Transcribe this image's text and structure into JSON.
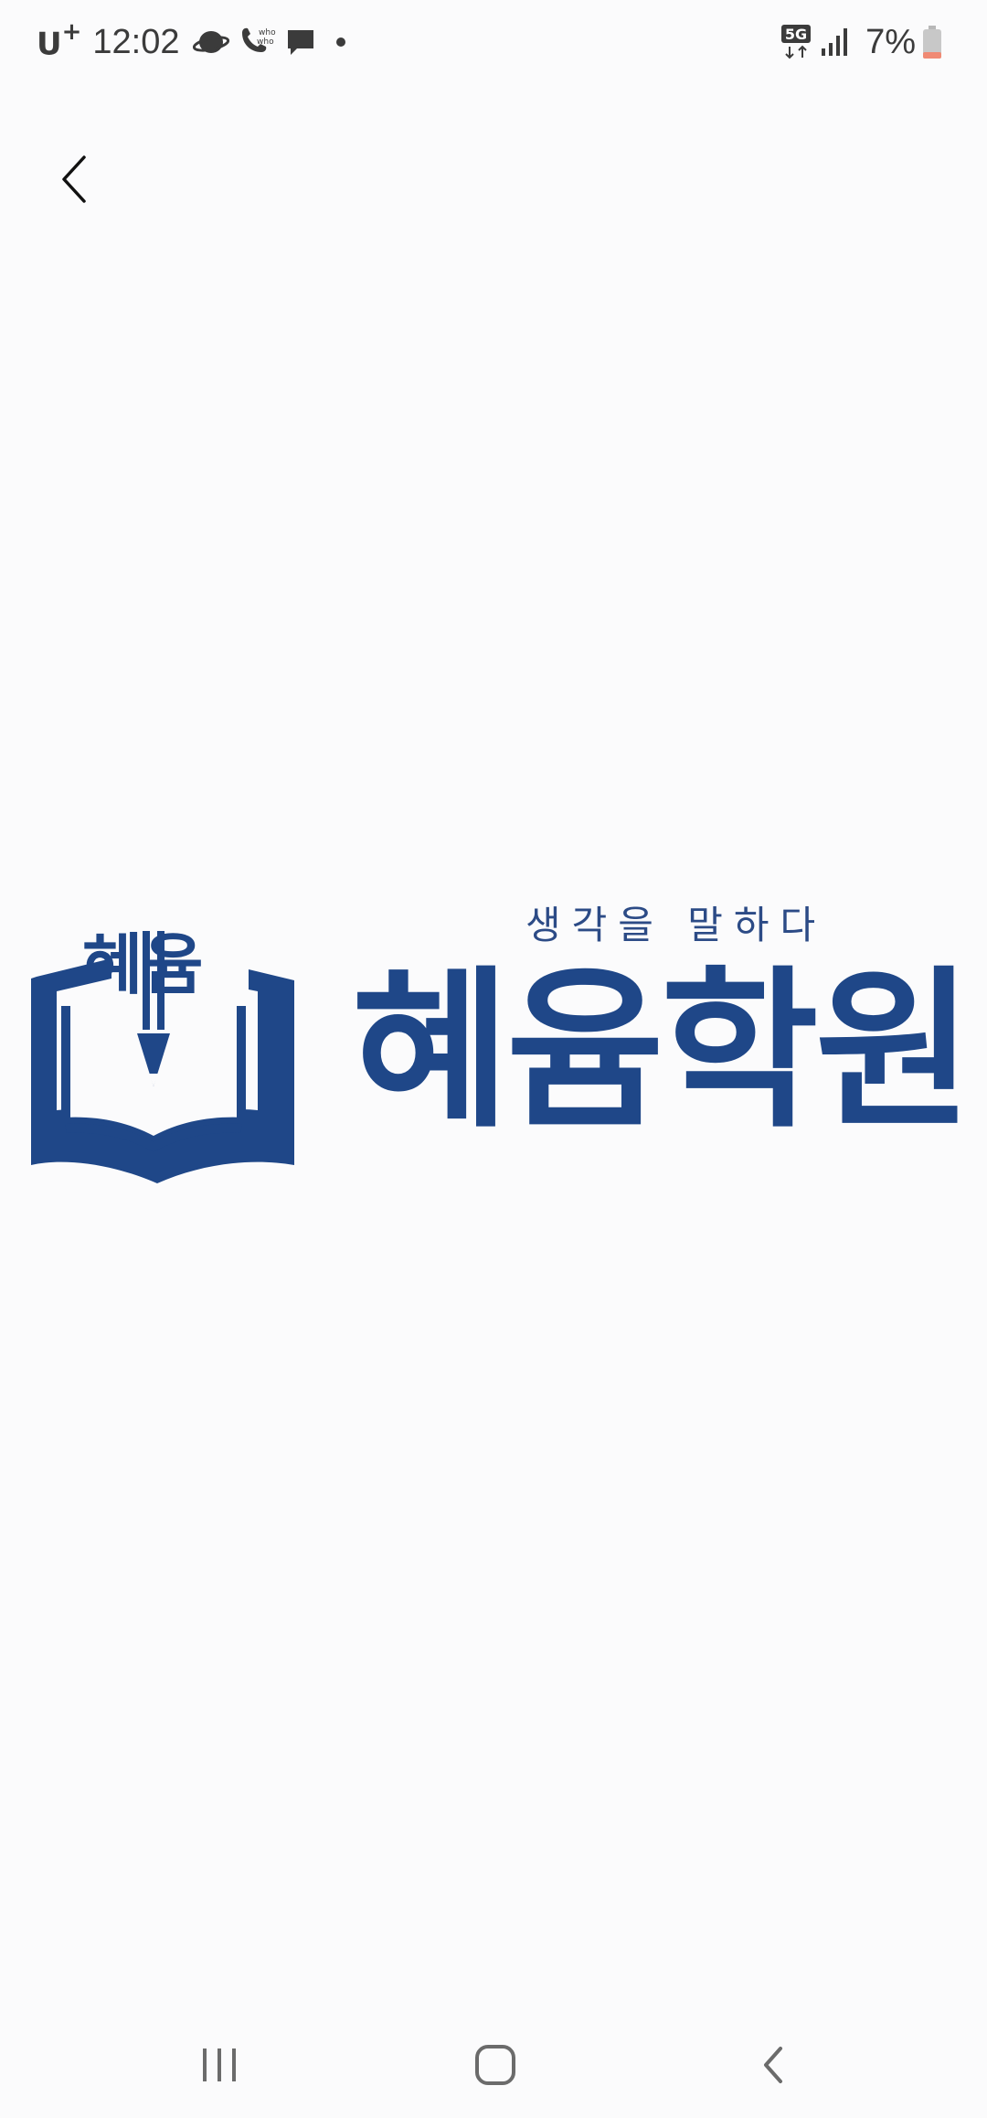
{
  "status_bar": {
    "carrier": "U",
    "carrier_plus": "+",
    "time": "12:02",
    "network": "5G",
    "battery_percent": "7%",
    "icons_left": [
      "saturn-icon",
      "whowho-call-icon",
      "chat-bubble-icon",
      "notification-dot-icon"
    ],
    "icons_right": [
      "5g-icon",
      "signal-icon",
      "battery-low-icon"
    ]
  },
  "header": {
    "back_icon": "chevron-left-icon"
  },
  "splash": {
    "emblem_text": "혜윰",
    "tagline": "생각을 말하다",
    "brand_name": "혜윰학원",
    "brand_color": "#1f4788"
  },
  "nav_bar": {
    "buttons": [
      "recent-apps-icon",
      "home-icon",
      "back-icon"
    ]
  }
}
